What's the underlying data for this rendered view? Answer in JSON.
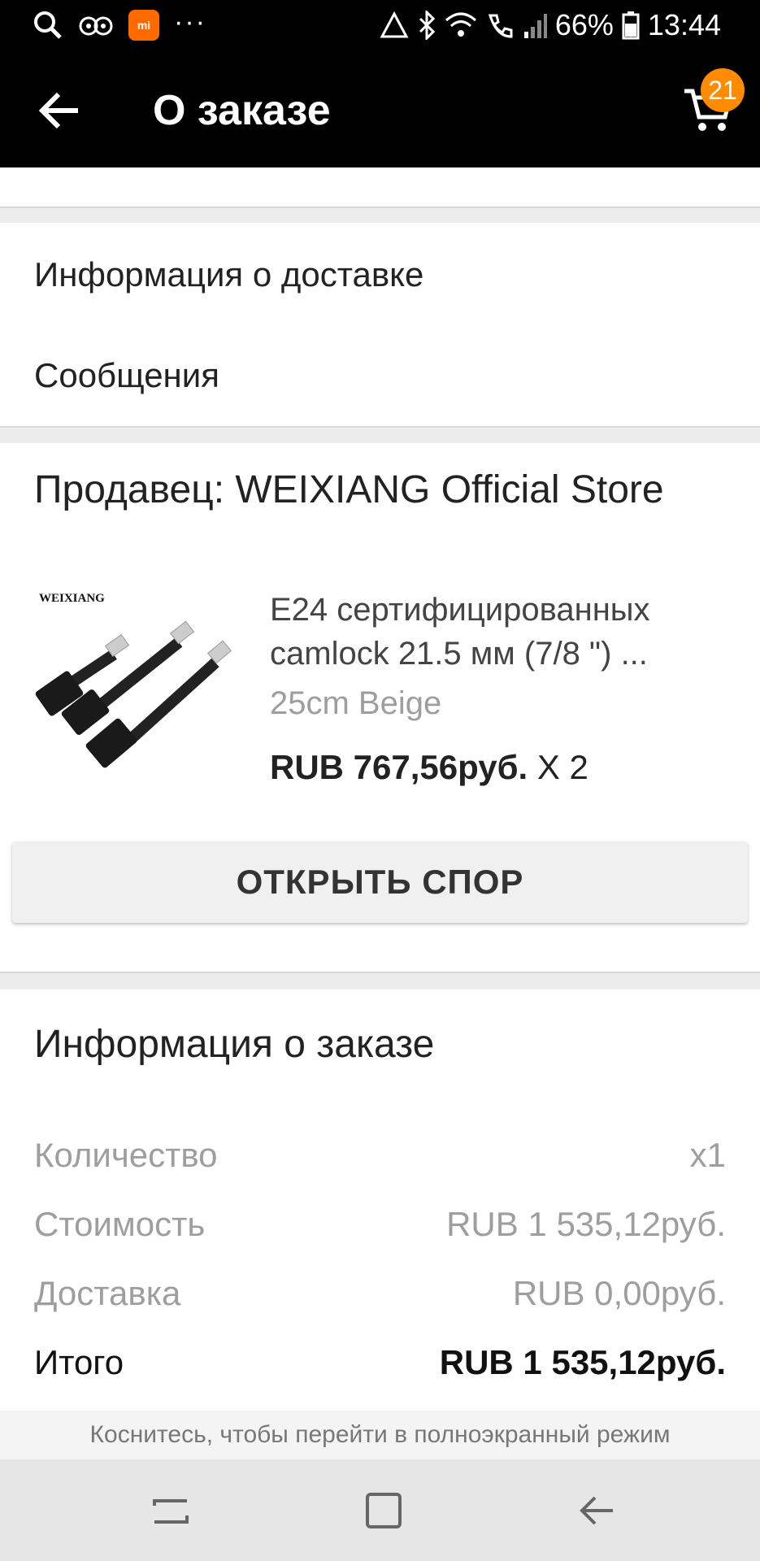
{
  "status_bar": {
    "battery": "66%",
    "time": "13:44",
    "mi_label": "mi",
    "more": "···"
  },
  "app_bar": {
    "title": "О заказе",
    "cart_count": "21"
  },
  "menu": {
    "delivery_info": "Информация о доставке",
    "messages": "Сообщения"
  },
  "seller": {
    "label": "Продавец: WEIXIANG Official Store"
  },
  "product": {
    "brand": "WEIXIANG",
    "title_line1": "E24 сертифицированных",
    "title_line2": "camlock 21.5 мм (7/8 \") ...",
    "variant": "25cm Beige",
    "price": "RUB 767,56руб.",
    "qty": " X 2"
  },
  "dispute_button": "ОТКРЫТЬ СПОР",
  "order_info": {
    "title": "Информация о заказе",
    "rows": [
      {
        "label": "Количество",
        "value": "x1"
      },
      {
        "label": "Стоимость",
        "value": "RUB 1 535,12руб."
      },
      {
        "label": "Доставка",
        "value": "RUB 0,00руб."
      },
      {
        "label": "Итого",
        "value": "RUB 1 535,12руб."
      }
    ]
  },
  "hint": "Коснитесь, чтобы перейти в полноэкранный режим",
  "colors": {
    "accent": "#ff8c00",
    "appbar": "#000000"
  }
}
